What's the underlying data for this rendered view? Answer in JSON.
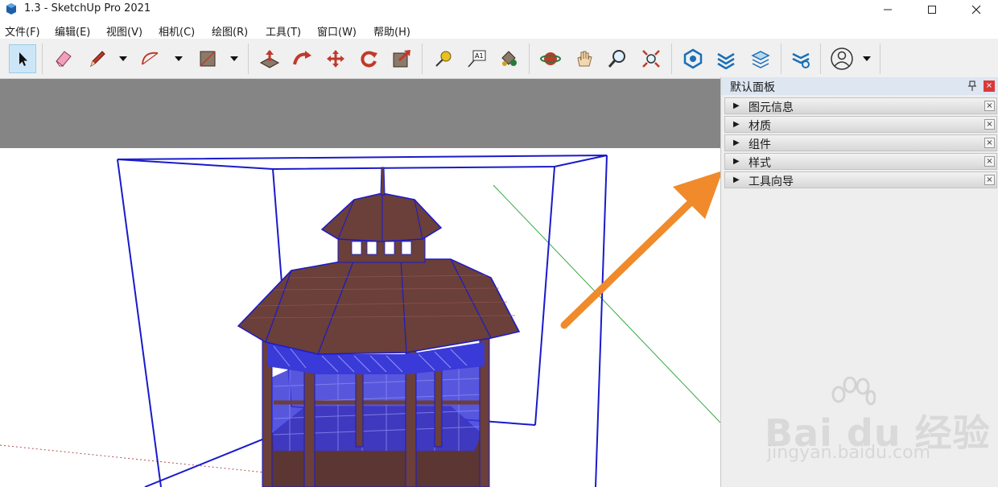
{
  "window": {
    "title": "1.3 - SketchUp Pro 2021"
  },
  "menu": [
    "文件(F)",
    "编辑(E)",
    "视图(V)",
    "相机(C)",
    "绘图(R)",
    "工具(T)",
    "窗口(W)",
    "帮助(H)"
  ],
  "toolbar": {
    "tools": [
      "select-icon",
      "eraser-icon",
      "pencil-line-icon",
      "arc-icon",
      "rectangle-icon",
      "push-pull-icon",
      "follow-me-icon",
      "move-icon",
      "rotate-icon",
      "scale-icon",
      "tape-measure-icon",
      "text-label-icon",
      "paint-bucket-icon",
      "orbit-icon",
      "pan-icon",
      "zoom-icon",
      "zoom-extents-icon",
      "3d-warehouse-icon",
      "extension-warehouse-icon",
      "layout-send-icon",
      "extension-manager-icon",
      "account-icon"
    ],
    "text_tool_glyph": "A1"
  },
  "panel": {
    "title": "默认面板",
    "trays": [
      {
        "label": "图元信息"
      },
      {
        "label": "材质"
      },
      {
        "label": "组件"
      },
      {
        "label": "样式"
      },
      {
        "label": "工具向导"
      }
    ]
  },
  "watermark": {
    "brand": "Bai du 经验",
    "url": "jingyan.baidu.com"
  },
  "colors": {
    "sky": "#858585",
    "selection_box": "#1a1acc",
    "gazebo": "#6b3f3a",
    "arrow": "#f08a2a",
    "green_axis": "#3aa845",
    "panel_header": "#dde6f1"
  }
}
